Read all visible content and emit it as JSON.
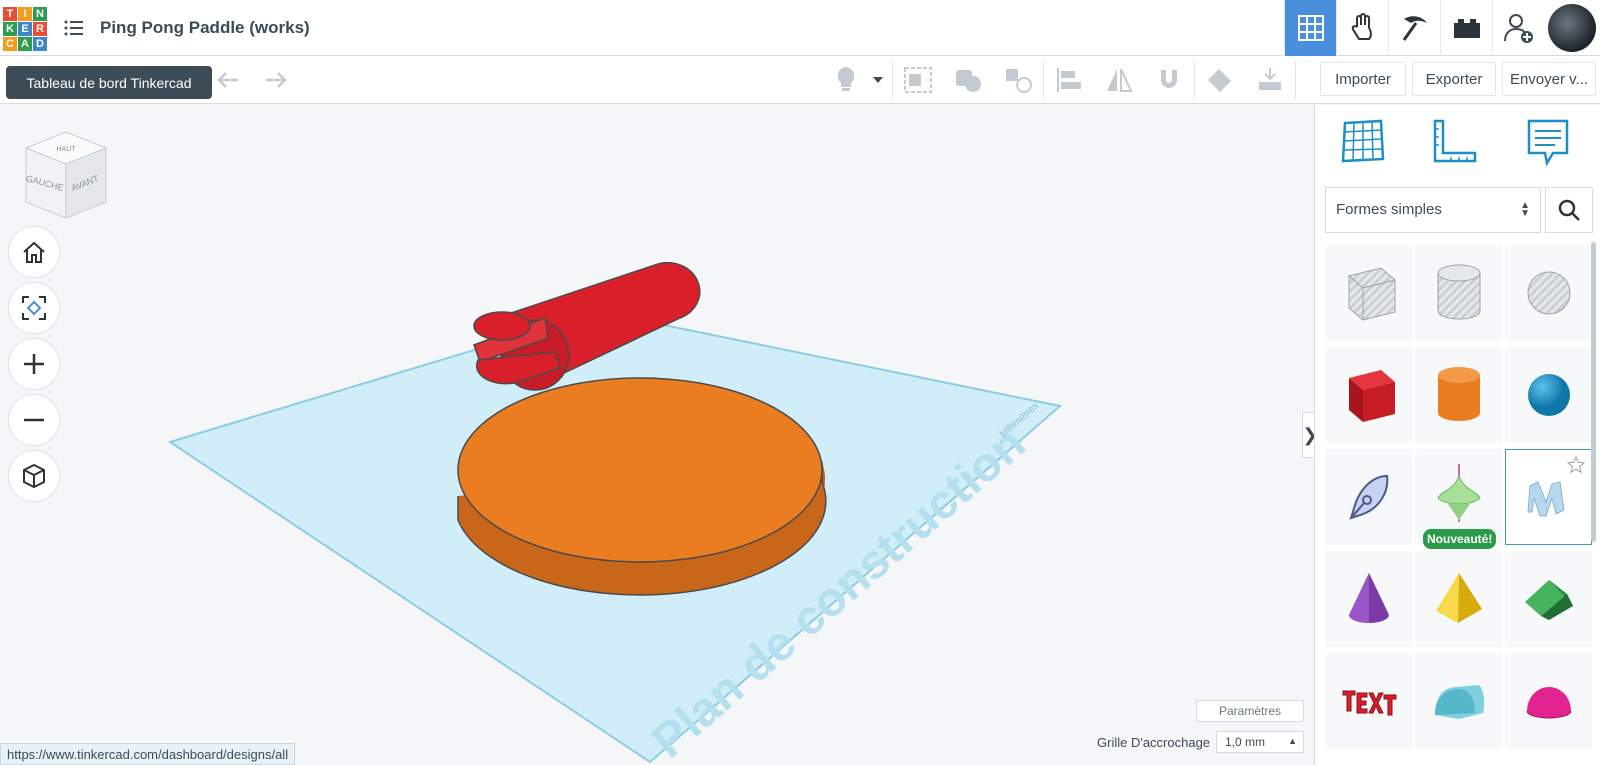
{
  "app": {
    "logo_letters": [
      "T",
      "I",
      "N",
      "K",
      "E",
      "R",
      "C",
      "A",
      "D"
    ],
    "logo_colors": [
      "#e94d35",
      "#f39c1e",
      "#2e9d4d",
      "#2e9d4d",
      "#3d86c6",
      "#e94d35",
      "#f39c1e",
      "#2e9d4d",
      "#3d86c6"
    ],
    "title": "Ping Pong Paddle (works)",
    "tooltip": "Tableau de bord Tinkercad"
  },
  "top_icons": [
    "grid-view-icon",
    "hand-icon",
    "pickaxe-icon",
    "brick-icon",
    "add-user-icon",
    "avatar"
  ],
  "toolbar": {
    "import_label": "Importer",
    "export_label": "Exporter",
    "send_label": "Envoyer v..."
  },
  "workspace": {
    "viewcube": {
      "top": "HAUT",
      "left": "GAUCHE",
      "front": "AVANT"
    },
    "plane_label": "Plan de construction",
    "plane_unit": "Millimètres",
    "settings_label": "Paramètres",
    "snap_label": "Grille D'accrochage",
    "snap_value": "1,0 mm"
  },
  "status_url": "https://www.tinkercad.com/dashboard/designs/all",
  "panel": {
    "category": "Formes simples",
    "new_badge": "Nouveauté!",
    "colors": {
      "accent": "#4a8fdb",
      "red": "#d9202a",
      "orange": "#ea7d20",
      "teal": "#1e8fc4",
      "purple": "#7b3aa6",
      "yellow": "#f2c81a",
      "green": "#2e9d4d",
      "pink": "#e0238e"
    }
  }
}
